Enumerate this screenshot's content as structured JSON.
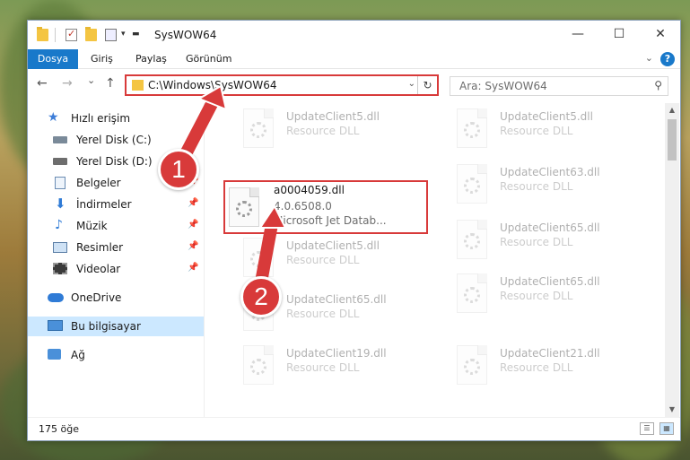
{
  "window": {
    "title": "SysWOW64",
    "controls": {
      "minimize": "—",
      "maximize": "☐",
      "close": "✕"
    }
  },
  "ribbon": {
    "tabs": [
      {
        "label": "Dosya"
      },
      {
        "label": "Giriş"
      },
      {
        "label": "Paylaş"
      },
      {
        "label": "Görünüm"
      }
    ],
    "help": "?"
  },
  "navigation": {
    "back": "←",
    "forward": "→",
    "recent": "⌄",
    "up": "↑",
    "address": "C:\\Windows\\SysWOW64",
    "search_placeholder": "Ara: SysWOW64"
  },
  "sidebar": {
    "items": [
      {
        "label": "Hızlı erişim",
        "icon": "star-icon"
      },
      {
        "label": "Yerel Disk (C:)",
        "icon": "drive-icon"
      },
      {
        "label": "Yerel Disk (D:)",
        "icon": "drive-icon"
      },
      {
        "label": "Belgeler",
        "icon": "documents-icon"
      },
      {
        "label": "İndirmeler",
        "icon": "download-icon"
      },
      {
        "label": "Müzik",
        "icon": "music-icon"
      },
      {
        "label": "Resimler",
        "icon": "pictures-icon"
      },
      {
        "label": "Videolar",
        "icon": "videos-icon"
      },
      {
        "label": "OneDrive",
        "icon": "cloud-icon"
      },
      {
        "label": "Bu bilgisayar",
        "icon": "computer-icon"
      },
      {
        "label": "Ağ",
        "icon": "network-icon"
      }
    ]
  },
  "files": {
    "left": [
      {
        "name": "UpdateClient5.dll",
        "line1": "Resource DLL"
      },
      {
        "name": "a0004059.dll",
        "line1": "4.0.6508.0",
        "line2": "Microsoft Jet Datab..."
      },
      {
        "name": "UpdateClient5.dll",
        "line1": "Resource DLL"
      },
      {
        "name": "UpdateClient65.dll",
        "line1": "Resource DLL"
      },
      {
        "name": "UpdateClient19.dll",
        "line1": "Resource DLL"
      }
    ],
    "right": [
      {
        "name": "UpdateClient5.dll",
        "line1": "Resource DLL"
      },
      {
        "name": "UpdateClient63.dll",
        "line1": "Resource DLL"
      },
      {
        "name": "UpdateClient65.dll",
        "line1": "Resource DLL"
      },
      {
        "name": "UpdateClient65.dll",
        "line1": "Resource DLL"
      },
      {
        "name": "UpdateClient21.dll",
        "line1": "Resource DLL"
      }
    ]
  },
  "status": {
    "count": "175 öğe"
  },
  "annotations": {
    "step1": "1",
    "step2": "2",
    "color": "#d83a3a"
  }
}
